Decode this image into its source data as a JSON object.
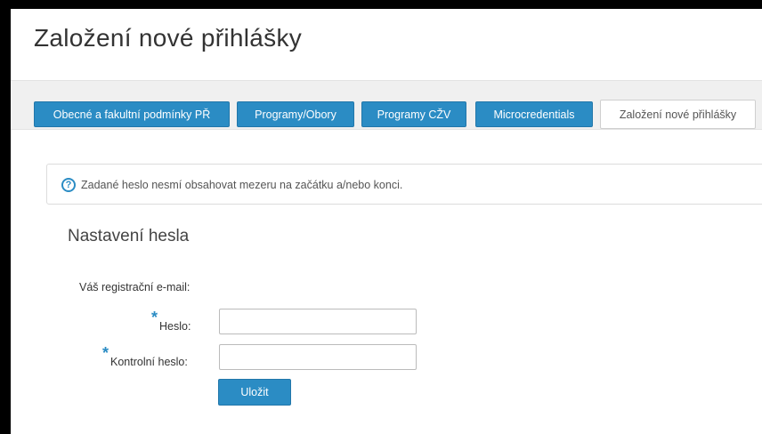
{
  "page": {
    "title": "Založení nové přihlášky"
  },
  "nav": {
    "tabs": [
      {
        "label": "Obecné a fakultní podmínky PŘ"
      },
      {
        "label": "Programy/Obory"
      },
      {
        "label": "Programy CŽV"
      },
      {
        "label": "Microcredentials"
      },
      {
        "label": "Založení nové přihlášky",
        "active": true
      }
    ]
  },
  "info": {
    "icon": "question-circle-icon",
    "text": "Zadané heslo nesmí obsahovat mezeru na začátku a/nebo konci."
  },
  "form": {
    "title": "Nastavení hesla",
    "email_label": "Váš registrační e-mail:",
    "password_label": "Heslo:",
    "password_value": "",
    "confirm_label": "Kontrolní heslo:",
    "confirm_value": "",
    "required_mark": "*",
    "save_label": "Uložit"
  },
  "colors": {
    "accent": "#2b8cc4",
    "nav_bg": "#f0f0f0"
  }
}
